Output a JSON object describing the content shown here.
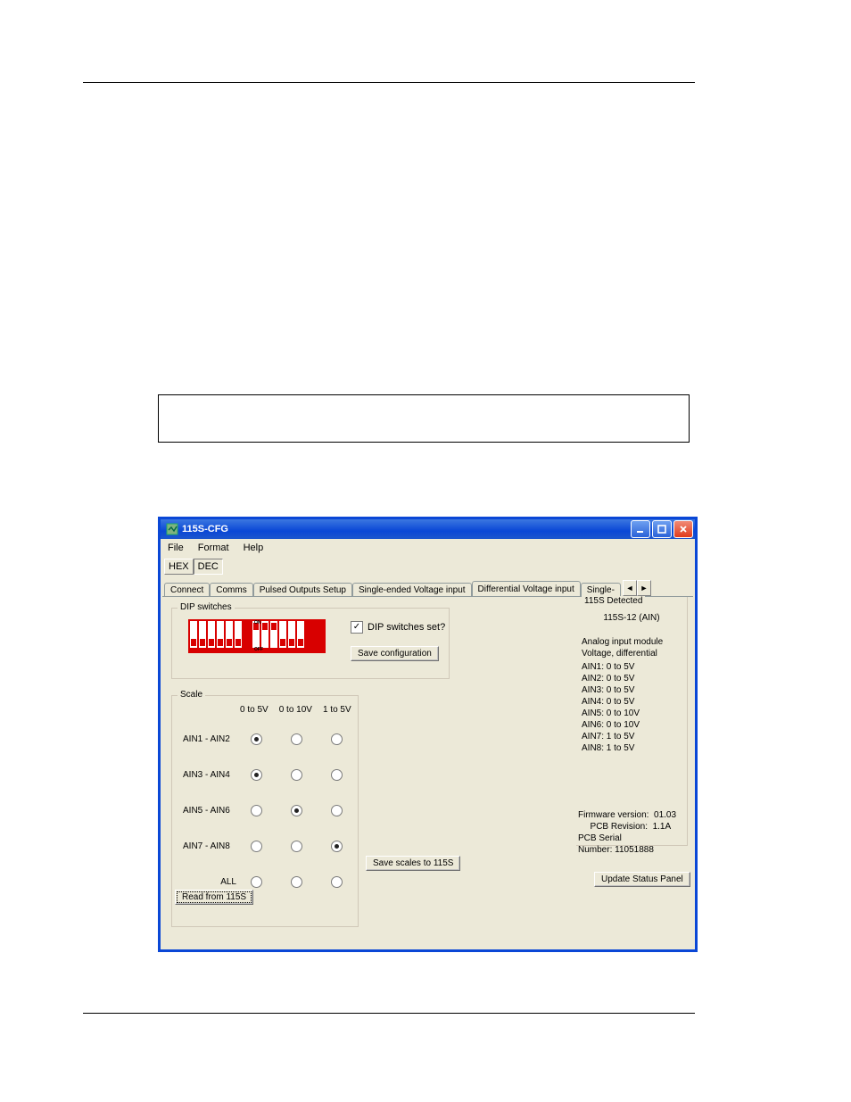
{
  "window": {
    "title": "115S-CFG"
  },
  "menu": [
    "File",
    "Format",
    "Help"
  ],
  "toolbar": {
    "hex": "HEX",
    "dec": "DEC"
  },
  "tabs": {
    "items": [
      "Connect",
      "Comms",
      "Pulsed Outputs Setup",
      "Single-ended Voltage input",
      "Differential Voltage input",
      "Single-"
    ],
    "active": 4
  },
  "dip": {
    "legend": "DIP switches",
    "check_label": "DIP switches set?",
    "checked": true,
    "save_btn": "Save configuration",
    "bank1": [
      "down",
      "down",
      "down",
      "down",
      "down",
      "down"
    ],
    "bank2": [
      "up",
      "up",
      "up",
      "down",
      "down",
      "down"
    ]
  },
  "scale": {
    "legend": "Scale",
    "cols": [
      "0 to 5V",
      "0 to 10V",
      "1 to 5V"
    ],
    "rows": [
      {
        "label": "AIN1 - AIN2",
        "sel": 0
      },
      {
        "label": "AIN3 - AIN4",
        "sel": 0
      },
      {
        "label": "AIN5 - AIN6",
        "sel": 1
      },
      {
        "label": "AIN7 - AIN8",
        "sel": 2
      },
      {
        "label": "ALL",
        "sel": -1
      }
    ],
    "save_btn": "Save scales to 115S",
    "read_btn": "Read from 115S"
  },
  "status": {
    "legend": "115S Detected",
    "model": "115S-12 (AIN)",
    "desc1": "Analog input module",
    "desc2": "Voltage, differential",
    "ain": [
      "AIN1: 0 to 5V",
      "AIN2: 0 to 5V",
      "AIN3: 0 to 5V",
      "AIN4: 0 to 5V",
      "AIN5: 0 to 10V",
      "AIN6: 0 to 10V",
      "AIN7: 1 to 5V",
      "AIN8: 1 to 5V"
    ],
    "fw_label": "Firmware version:",
    "fw": "01.03",
    "pcb_label": "PCB Revision:",
    "pcb": "1.1A",
    "sn_label": "PCB Serial Number:",
    "sn": "11051888",
    "update_btn": "Update Status Panel"
  }
}
